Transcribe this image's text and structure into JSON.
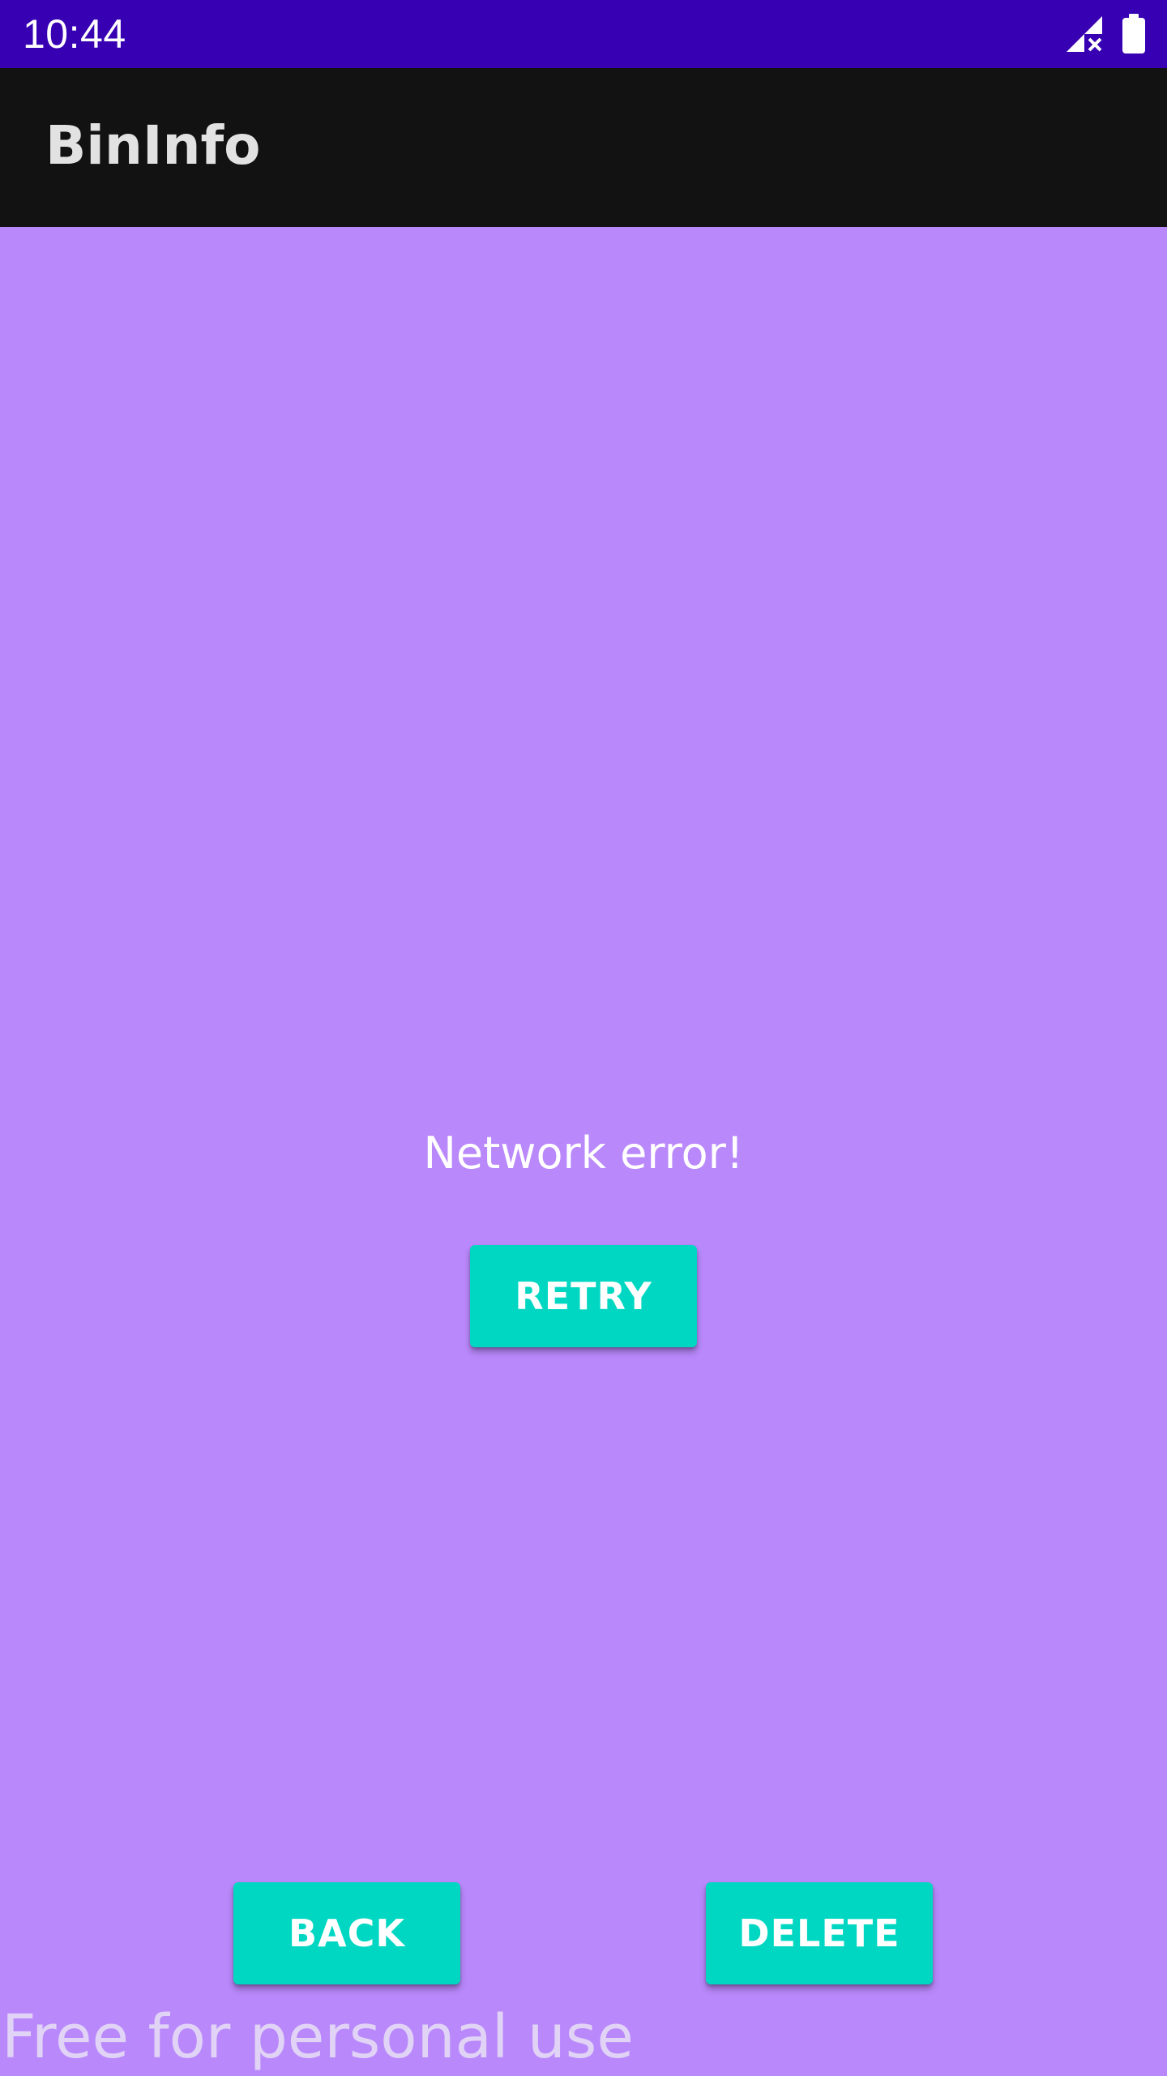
{
  "status_bar": {
    "time": "10:44",
    "icons": [
      "signal-no-service-icon",
      "battery-icon"
    ],
    "background": "#3700b3"
  },
  "app_bar": {
    "title": "BinInfo",
    "background": "#121212"
  },
  "main": {
    "background": "#b988fb",
    "message": "Network error!",
    "retry_label": "RETRY"
  },
  "bottom_actions": {
    "back_label": "BACK",
    "delete_label": "DELETE",
    "button_color": "#00d7c2"
  },
  "watermark": {
    "text": "Free for personal use"
  }
}
